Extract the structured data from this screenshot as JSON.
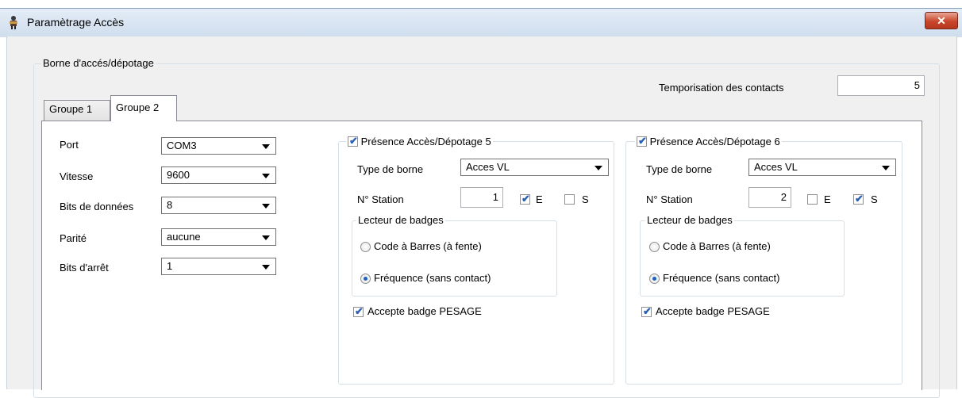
{
  "window": {
    "title": "Paramètrage Accès",
    "icon": "app-icon",
    "close_icon": "close-icon",
    "close_glyph": "✕"
  },
  "borne_group": {
    "legend": "Borne d'accés/dépotage",
    "temporisation_label": "Temporisation des contacts",
    "temporisation_value": "5"
  },
  "tabs": [
    {
      "label": "Groupe 1",
      "active": false
    },
    {
      "label": "Groupe 2",
      "active": true
    }
  ],
  "serial": {
    "port_label": "Port",
    "port_value": "COM3",
    "vitesse_label": "Vitesse",
    "vitesse_value": "9600",
    "bits_donnees_label": "Bits de données",
    "bits_donnees_value": "8",
    "parite_label": "Parité",
    "parite_value": "aucune",
    "bits_arret_label": "Bits d'arrêt",
    "bits_arret_value": "1"
  },
  "acces": [
    {
      "presence_label": "Présence Accès/Dépotage 5",
      "presence_checked": true,
      "type_label": "Type de borne",
      "type_value": "Acces VL",
      "station_label": "N° Station",
      "station_value": "1",
      "e_label": "E",
      "e_checked": true,
      "s_label": "S",
      "s_checked": false,
      "lecteur_legend": "Lecteur de badges",
      "code_barres_label": "Code à Barres (à fente)",
      "frequence_label": "Fréquence (sans contact)",
      "selected_reader": "frequence",
      "pesage_label": "Accepte badge PESAGE",
      "pesage_checked": true
    },
    {
      "presence_label": "Présence Accès/Dépotage 6",
      "presence_checked": true,
      "type_label": "Type de borne",
      "type_value": "Acces VL",
      "station_label": "N° Station",
      "station_value": "2",
      "e_label": "E",
      "e_checked": false,
      "s_label": "S",
      "s_checked": true,
      "lecteur_legend": "Lecteur de badges",
      "code_barres_label": "Code à Barres (à fente)",
      "frequence_label": "Fréquence (sans contact)",
      "selected_reader": "frequence",
      "pesage_label": "Accepte badge PESAGE",
      "pesage_checked": true
    }
  ],
  "check_glyph": "✔"
}
